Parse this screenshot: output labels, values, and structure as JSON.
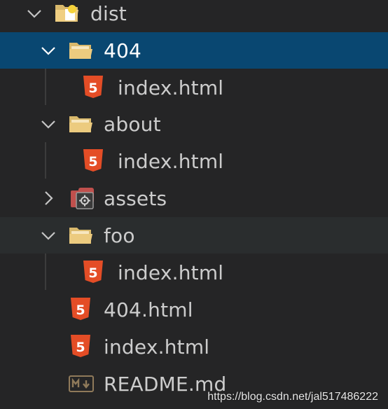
{
  "explorer": {
    "items": [
      {
        "name": "dist",
        "type": "folder",
        "expanded": true,
        "icon": "folder-open-dist-icon"
      },
      {
        "name": "404",
        "type": "folder",
        "expanded": true,
        "selected": true,
        "icon": "folder-open-icon"
      },
      {
        "name": "index.html",
        "type": "file",
        "icon": "html5-icon"
      },
      {
        "name": "about",
        "type": "folder",
        "expanded": true,
        "icon": "folder-open-icon"
      },
      {
        "name": "index.html",
        "type": "file",
        "icon": "html5-icon"
      },
      {
        "name": "assets",
        "type": "folder",
        "expanded": false,
        "icon": "assets-folder-icon"
      },
      {
        "name": "foo",
        "type": "folder",
        "expanded": true,
        "icon": "folder-open-icon"
      },
      {
        "name": "index.html",
        "type": "file",
        "icon": "html5-icon"
      },
      {
        "name": "404.html",
        "type": "file",
        "icon": "html5-icon"
      },
      {
        "name": "index.html",
        "type": "file",
        "icon": "html5-icon"
      },
      {
        "name": "README.md",
        "type": "file",
        "icon": "markdown-icon"
      }
    ]
  },
  "watermark": "https://blog.csdn.net/jal517486222",
  "colors": {
    "background": "#252526",
    "selection": "#094771",
    "hover": "#2a2d2e",
    "text": "#cccccc",
    "folder": "#e8c478",
    "html5": "#e44d26"
  }
}
